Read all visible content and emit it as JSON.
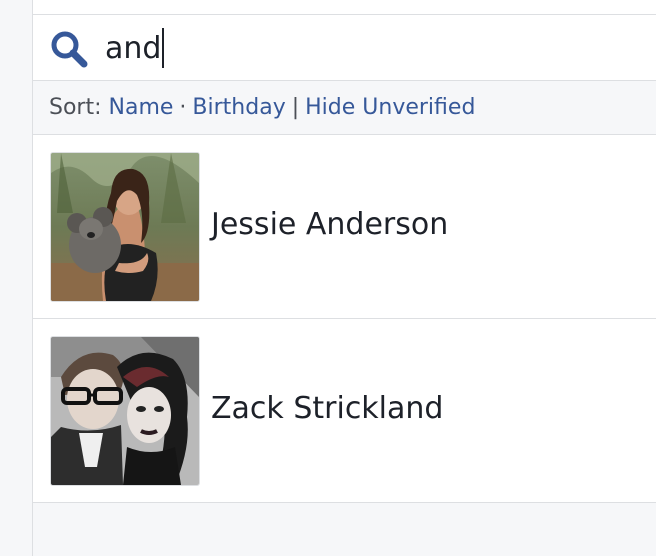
{
  "search": {
    "value": "and",
    "icon": "search-icon",
    "icon_color": "#365899"
  },
  "sort": {
    "label": "Sort:",
    "options": [
      "Name",
      "Birthday"
    ],
    "bullet": "·",
    "divider": "|",
    "hide_unverified": "Hide Unverified",
    "link_color": "#365899"
  },
  "results": [
    {
      "name": "Jessie Anderson",
      "avatar": "profile-photo-woman-holding-koala"
    },
    {
      "name": "Zack Strickland",
      "avatar": "profile-photo-couple-selfie"
    }
  ]
}
